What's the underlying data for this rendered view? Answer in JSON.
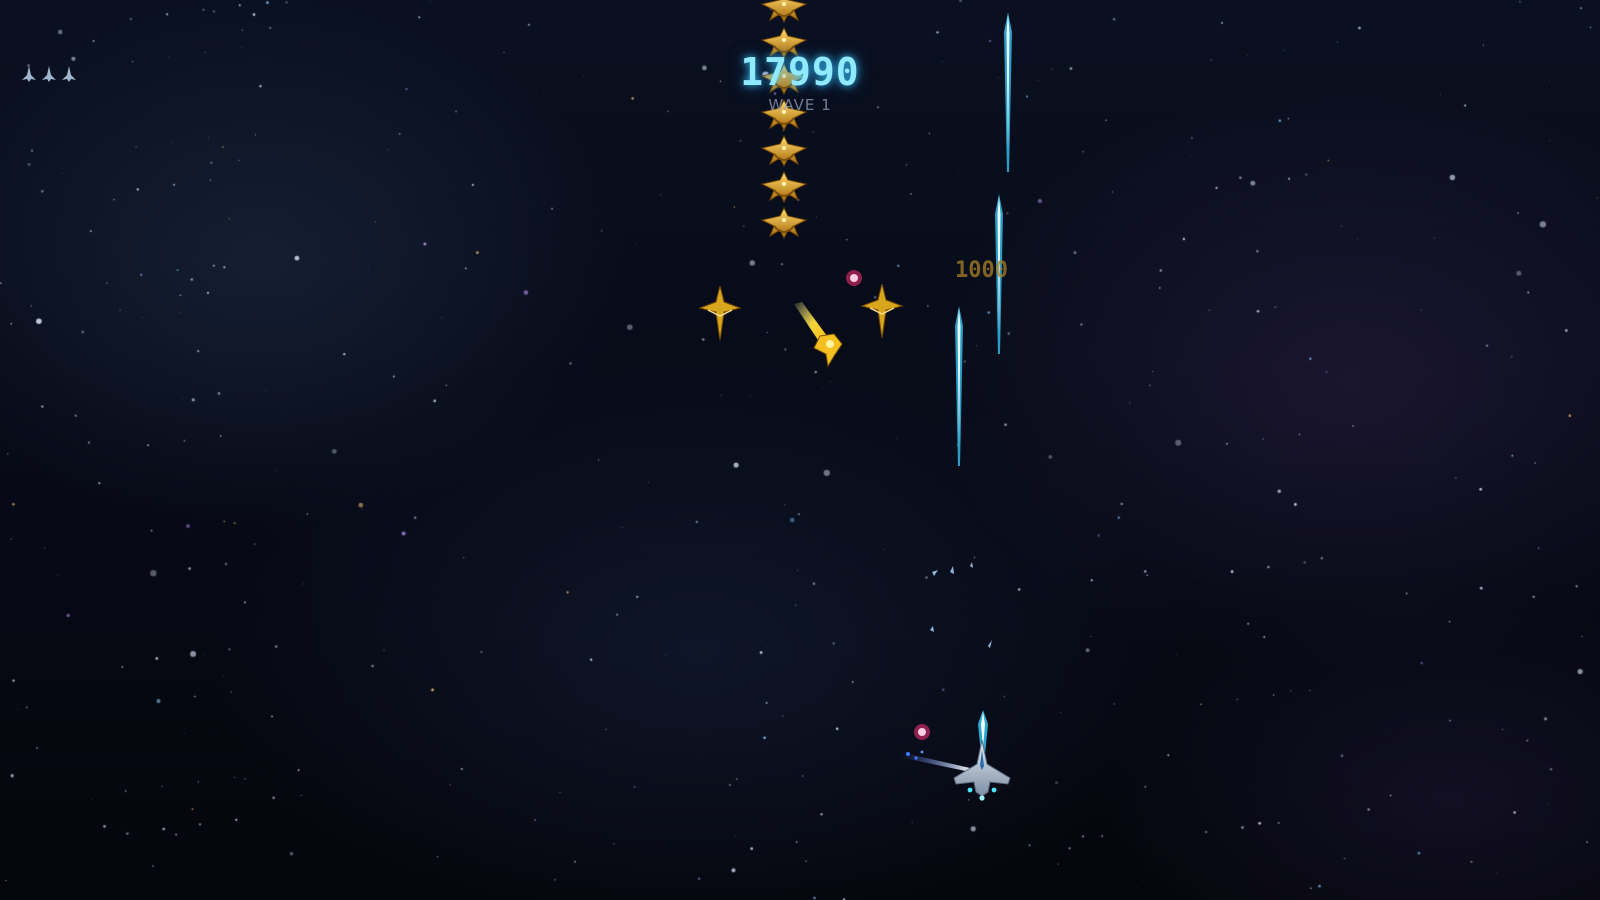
{
  "hud": {
    "score": "17990",
    "wave": "WAVE 1",
    "lives": 3
  },
  "popup": {
    "points": "1000"
  },
  "icons": {
    "life": "player-ship-icon",
    "enemy": "gold-fighter-icon",
    "player": "player-starfighter-icon"
  },
  "colors": {
    "score": "#8fe9ff",
    "laser": "#4fe6ff",
    "enemy_gold": "#d9a51c",
    "enemy_bullet": "#ff2f7a",
    "background": "#070a16"
  }
}
